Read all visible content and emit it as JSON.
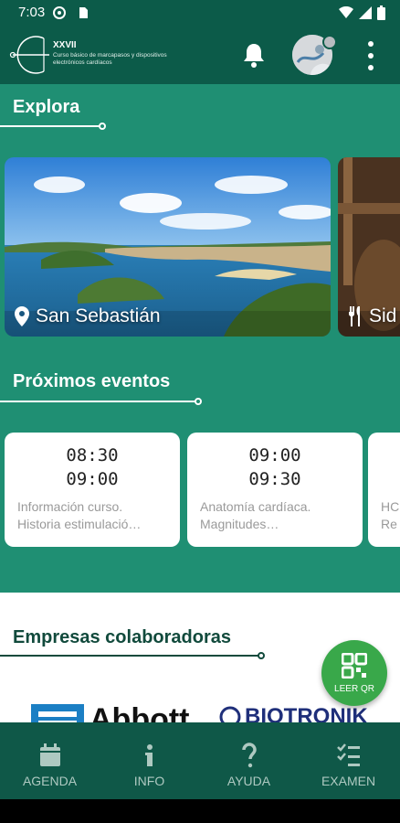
{
  "status_bar": {
    "time": "7:03"
  },
  "header": {
    "logo_title": "XXVII",
    "logo_subtitle": "Curso básico de marcapasos y dispositivos electrónicos cardíacos"
  },
  "explore": {
    "title": "Explora",
    "cards": [
      {
        "label": "San Sebastián",
        "icon": "location-pin-icon"
      },
      {
        "label": "Sid",
        "icon": "fork-knife-icon"
      }
    ]
  },
  "events": {
    "title": "Próximos eventos",
    "items": [
      {
        "start": "08:30",
        "end": "09:00",
        "desc1": "Información curso.",
        "desc2": "Historia estimulació…"
      },
      {
        "start": "09:00",
        "end": "09:30",
        "desc1": "Anatomía cardíaca.",
        "desc2": "Magnitudes…"
      },
      {
        "start": "",
        "end": "",
        "desc1": "HC",
        "desc2": "Re"
      }
    ]
  },
  "sponsors": {
    "title": "Empresas colaboradoras",
    "names": [
      "Abbott",
      "BIOTRONIK"
    ]
  },
  "qr_button": {
    "label": "LEER QR"
  },
  "bottom_nav": {
    "items": [
      {
        "label": "AGENDA",
        "icon": "calendar-icon"
      },
      {
        "label": "INFO",
        "icon": "info-icon"
      },
      {
        "label": "AYUDA",
        "icon": "help-icon"
      },
      {
        "label": "EXAMEN",
        "icon": "checklist-icon"
      }
    ]
  },
  "colors": {
    "primary_dark": "#0c5b49",
    "primary": "#1f8f73",
    "fab": "#39a84a",
    "nav_bg": "#0f5848"
  }
}
